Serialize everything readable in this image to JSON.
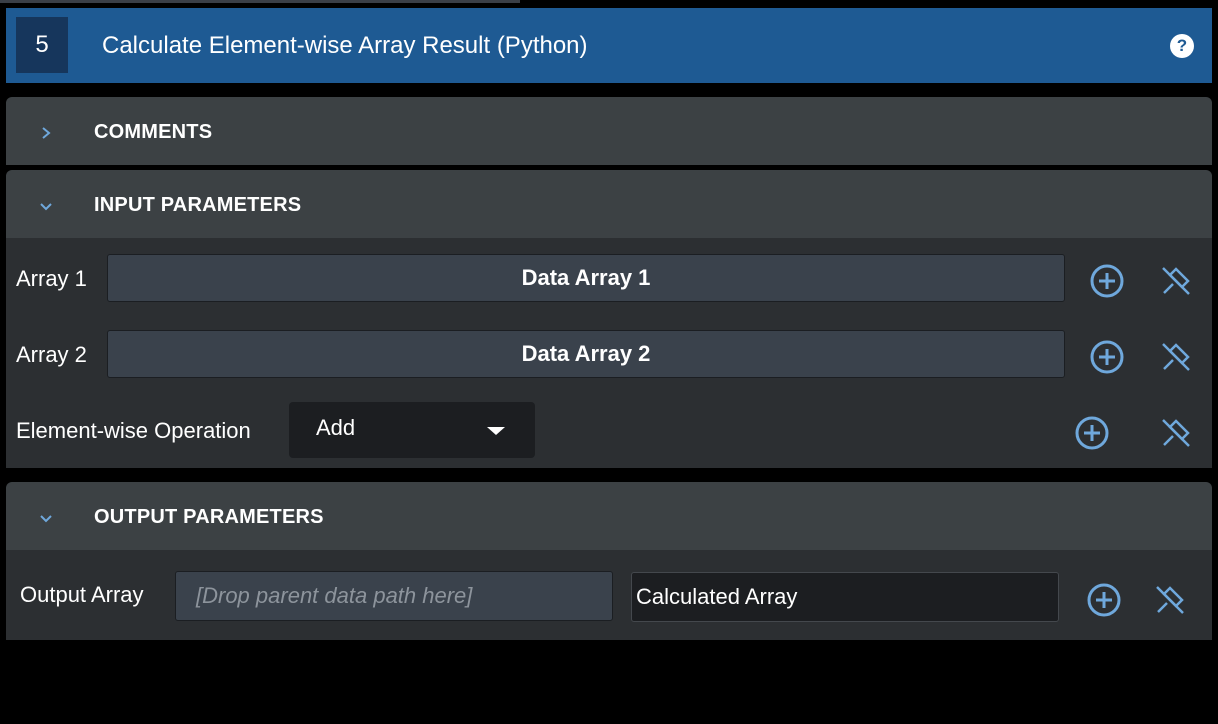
{
  "filter": {
    "index": "5",
    "title": "Calculate Element-wise Array Result (Python)",
    "help_icon": "question-circle-icon"
  },
  "sections": {
    "comments": {
      "label": "COMMENTS",
      "expanded": false
    },
    "input": {
      "label": "INPUT PARAMETERS",
      "expanded": true
    },
    "output": {
      "label": "OUTPUT PARAMETERS",
      "expanded": true
    }
  },
  "input_params": {
    "array1": {
      "label": "Array 1",
      "value": "Data Array 1"
    },
    "array2": {
      "label": "Array 2",
      "value": "Data Array 2"
    },
    "operation": {
      "label": "Element-wise Operation",
      "selected": "Add"
    }
  },
  "output_params": {
    "array": {
      "label": "Output Array",
      "placeholder": "[Drop parent data path here]",
      "name": "Calculated Array"
    }
  },
  "colors": {
    "header": "#1e5a93",
    "accent_icon": "#6fa8dc",
    "section_header": "#3c4144",
    "section_body": "#2c2f32"
  }
}
